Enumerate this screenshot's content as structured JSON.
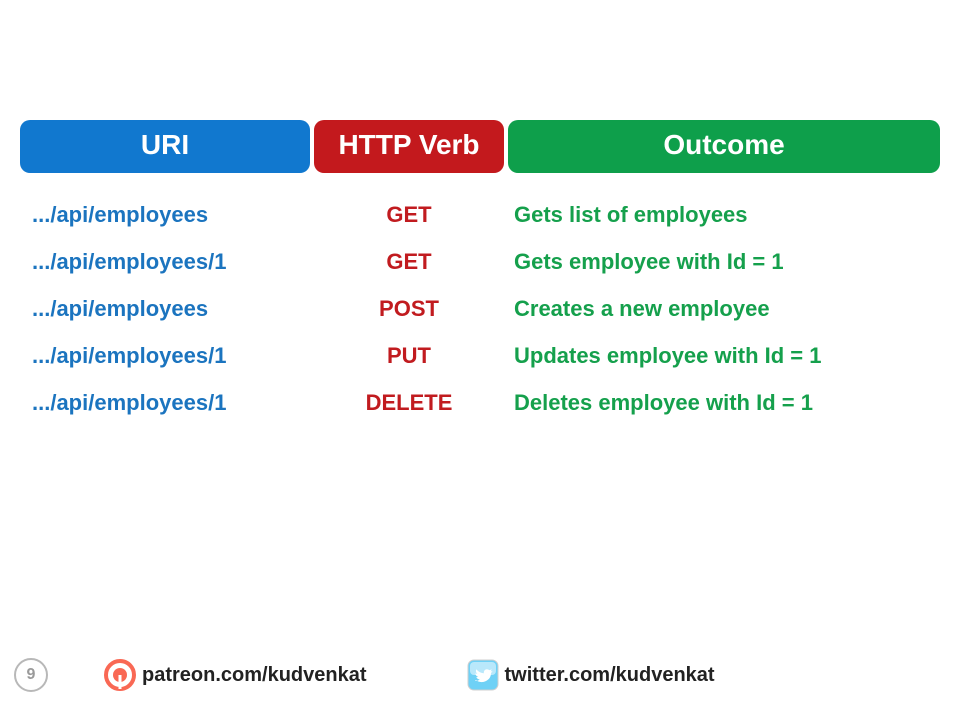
{
  "colors": {
    "blue": "#1178CF",
    "red": "#C3191D",
    "green": "#0E9F4B",
    "uri_text": "#1B74BF",
    "verb_text": "#C11B1F",
    "outcome_text": "#15A04C"
  },
  "headers": {
    "uri": "URI",
    "verb": "HTTP Verb",
    "outcome": "Outcome"
  },
  "rows": [
    {
      "uri": ".../api/employees",
      "verb": "GET",
      "outcome": "Gets list of employees"
    },
    {
      "uri": ".../api/employees/1",
      "verb": "GET",
      "outcome": "Gets employee with Id = 1"
    },
    {
      "uri": ".../api/employees",
      "verb": "POST",
      "outcome": "Creates a  new employee"
    },
    {
      "uri": ".../api/employees/1",
      "verb": "PUT",
      "outcome": "Updates employee with Id = 1"
    },
    {
      "uri": ".../api/employees/1",
      "verb": "DELETE",
      "outcome": "Deletes employee with Id = 1"
    }
  ],
  "footer": {
    "page_number": "9",
    "patreon_label": "patreon.com/kudvenkat",
    "twitter_label": "twitter.com/kudvenkat"
  }
}
